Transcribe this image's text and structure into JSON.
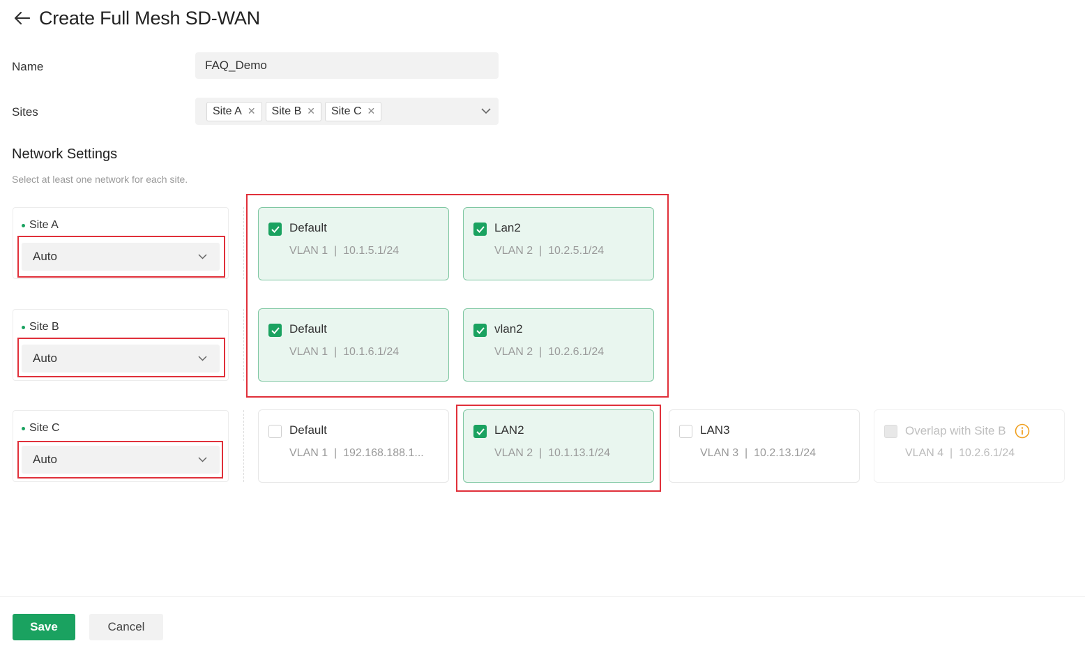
{
  "header": {
    "title": "Create Full Mesh SD-WAN"
  },
  "form": {
    "name_label": "Name",
    "name_value": "FAQ_Demo",
    "sites_label": "Sites",
    "site_tags": [
      "Site A",
      "Site B",
      "Site C"
    ]
  },
  "network_settings": {
    "title": "Network Settings",
    "description": "Select at least one network for each site.",
    "sites": [
      {
        "name": "Site A",
        "mode": "Auto",
        "networks": [
          {
            "name": "Default",
            "vlan": "VLAN 1",
            "subnet": "10.1.5.1/24",
            "checked": true
          },
          {
            "name": "Lan2",
            "vlan": "VLAN 2",
            "subnet": "10.2.5.1/24",
            "checked": true
          }
        ]
      },
      {
        "name": "Site B",
        "mode": "Auto",
        "networks": [
          {
            "name": "Default",
            "vlan": "VLAN 1",
            "subnet": "10.1.6.1/24",
            "checked": true
          },
          {
            "name": "vlan2",
            "vlan": "VLAN 2",
            "subnet": "10.2.6.1/24",
            "checked": true
          }
        ]
      },
      {
        "name": "Site C",
        "mode": "Auto",
        "networks": [
          {
            "name": "Default",
            "vlan": "VLAN 1",
            "subnet": "192.168.188.1...",
            "checked": false
          },
          {
            "name": "LAN2",
            "vlan": "VLAN 2",
            "subnet": "10.1.13.1/24",
            "checked": true
          },
          {
            "name": "LAN3",
            "vlan": "VLAN 3",
            "subnet": "10.2.13.1/24",
            "checked": false
          },
          {
            "name": "Overlap with Site B",
            "vlan": "VLAN 4",
            "subnet": "10.2.6.1/24",
            "checked": false,
            "disabled": true
          }
        ]
      }
    ]
  },
  "footer": {
    "save_label": "Save",
    "cancel_label": "Cancel"
  },
  "colors": {
    "accent": "#1aa260",
    "highlight": "#e0303a",
    "selected_bg": "#e9f6ef"
  }
}
